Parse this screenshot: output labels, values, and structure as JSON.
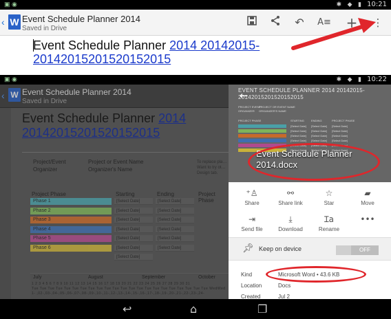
{
  "top": {
    "status_time": "10:21",
    "app_title": "Event Schedule Planner 2014",
    "app_subtitle": "Saved in Drive",
    "logo_letter": "W",
    "toolbar_icons": [
      "save-icon",
      "share-icon",
      "undo-icon",
      "text-format-icon",
      "add-icon",
      "overflow-menu-icon"
    ],
    "doc_heading_plain": "Event Schedule Planner ",
    "doc_heading_link": "2014 20142015-20142015201520152015"
  },
  "bottom": {
    "status_time": "10:22",
    "app_title": "Event Schedule Planner 2014",
    "app_subtitle": "Saved in Drive",
    "logo_letter": "W",
    "doc_heading_plain": "Event Schedule Planner ",
    "doc_heading_link": "2014 20142015201520152015",
    "project_event_label": "Project/Event",
    "project_event_value": "Project or Event Name",
    "organizer_label": "Organizer",
    "organizer_value": "Organizer's Name",
    "side_note": "To replace pla…\nWant to try ot…\nDesign tab.",
    "table_headers": [
      "Project Phase",
      "Starting",
      "Ending",
      "Project Phase"
    ],
    "phases": [
      {
        "label": "Phase 1",
        "color": "#4aa0a8",
        "start": "[Select Date]",
        "end": "[Select Date]"
      },
      {
        "label": "Phase 2",
        "color": "#7eb35a",
        "start": "[Select Date]",
        "end": "[Select Date]"
      },
      {
        "label": "Phase 3",
        "color": "#c86a2a",
        "start": "[Select Date]",
        "end": "[Select Date]"
      },
      {
        "label": "Phase 4",
        "color": "#3f6fb0",
        "start": "[Select Date]",
        "end": "[Select Date]"
      },
      {
        "label": "Phase 5",
        "color": "#b04a8e",
        "start": "[Select Date]",
        "end": "[Select Date]"
      },
      {
        "label": "Phase 6",
        "color": "#c9b13a",
        "start": "[Select Date]",
        "end": "[Select Date]"
      }
    ],
    "extra_date": "[Select Date]",
    "months": [
      "July",
      "August",
      "September",
      "October"
    ],
    "cal_row_1": "1  2  3  4  5  6  7  8  9  10  11 12 13 14 15 16 17 18 19 20 21 22 23 24 25 26 27 28 29 30 31",
    "cal_row_2": "Tue Tue Tue Tue Tue Tue Tue Tue Tue Tue Tue Tue Tue Tue Tue Tue Tue Tue Tue Tue Tue Tue WedWed",
    "cal_row_3": "1- ,02-,03-,04-,05-,06-,07-,08-,09-,10-,11-,12-,13-,14-,15-,16-,17-,18-,19-,20-,21-,22-,23-,24-"
  },
  "panel": {
    "thumb_title": "EVENT SCHEDULE PLANNER 2014 20142015-20142015201520152015",
    "thumb_labels": [
      "PROJECT EVENT",
      "PROJECT OR EVENT NAME",
      "ORGANIZER",
      "ORGANIZER'S NAME",
      "PROJECT PHASE",
      "STARTING",
      "ENDING",
      "PROJECT PHASE",
      "[Select Date]"
    ],
    "file_name": "Event Schedule Planner 2014.docx",
    "actions": [
      {
        "icon": "add-person-icon",
        "label": "Share"
      },
      {
        "icon": "link-icon",
        "label": "Share link"
      },
      {
        "icon": "star-icon",
        "label": "Star"
      },
      {
        "icon": "folder-move-icon",
        "label": "Move"
      },
      {
        "icon": "send-file-icon",
        "label": "Send file"
      },
      {
        "icon": "download-icon",
        "label": "Download"
      },
      {
        "icon": "rename-icon",
        "label": "Rename"
      },
      {
        "icon": "more-icon",
        "label": ""
      }
    ],
    "keep_label": "Keep on device",
    "toggle_state": "OFF",
    "details": [
      {
        "key": "Kind",
        "value": "Microsoft Word • 43.6 KB"
      },
      {
        "key": "Location",
        "value": "Docs"
      },
      {
        "key": "Created",
        "value": "Jul 2"
      }
    ]
  },
  "colors": {
    "annotation_red": "#e0262b",
    "docs_blue": "#2a62c8",
    "link_blue": "#1a3acb"
  }
}
